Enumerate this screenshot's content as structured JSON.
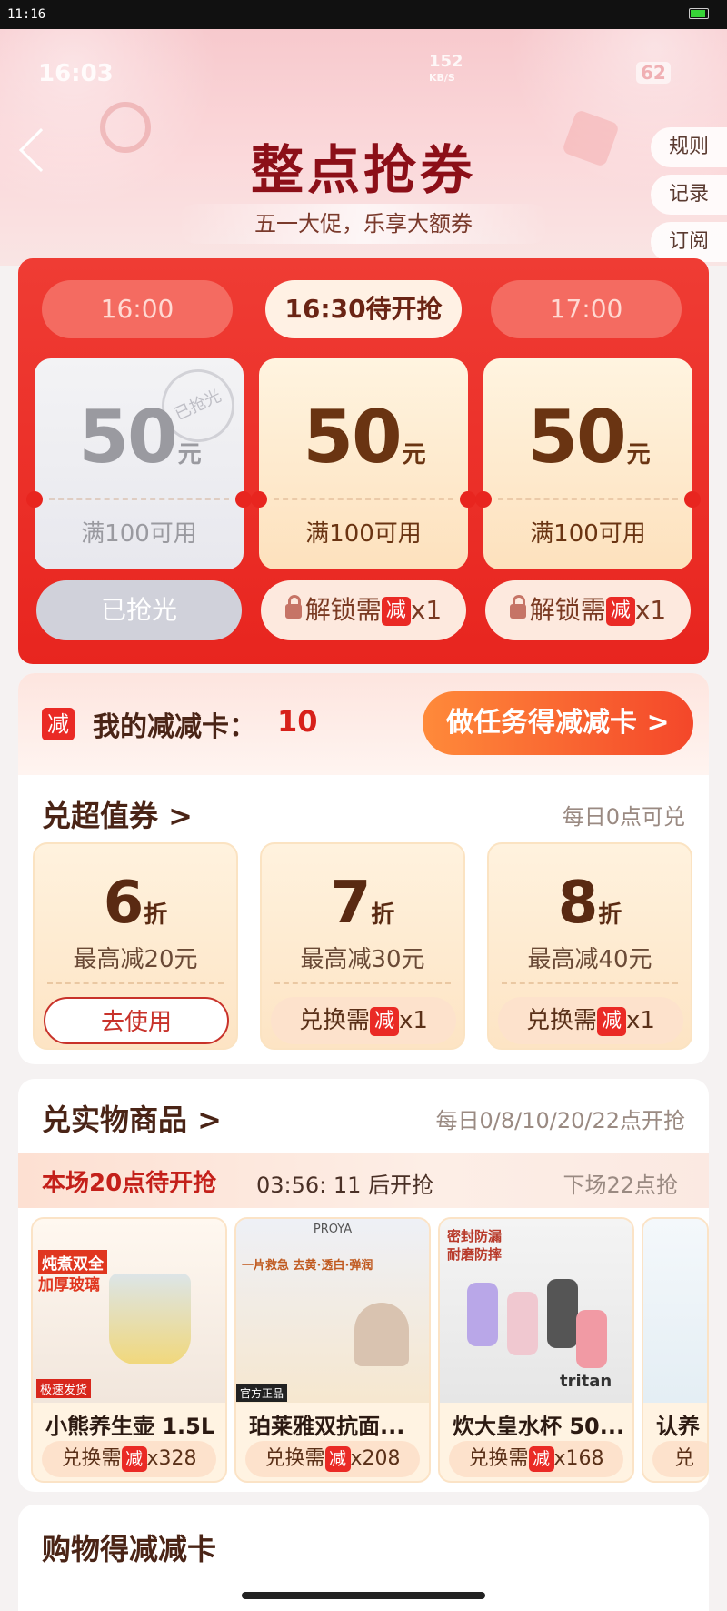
{
  "system": {
    "time": "11:16"
  },
  "status": {
    "time": "16:03",
    "net_speed": "152",
    "net_unit": "KB/S",
    "battery": "62"
  },
  "header": {
    "title": "整点抢券",
    "subtitle": "五一大促，乐享大额券",
    "side_links": [
      "规则",
      "记录",
      "订阅"
    ]
  },
  "timeslots": [
    "16:00",
    "16:30待开抢",
    "17:00"
  ],
  "coupons": [
    {
      "amount": "50",
      "unit": "元",
      "condition": "满100可用",
      "stamp": "已抢光",
      "button": "已抢光"
    },
    {
      "amount": "50",
      "unit": "元",
      "condition": "满100可用",
      "button_prefix": "解锁需",
      "button_icon": "减",
      "button_suffix": "x1"
    },
    {
      "amount": "50",
      "unit": "元",
      "condition": "满100可用",
      "button_prefix": "解锁需",
      "button_icon": "减",
      "button_suffix": "x1"
    }
  ],
  "mycard": {
    "icon": "减",
    "label": "我的减减卡：",
    "count": "10",
    "task_button": "做任务得减减卡 >"
  },
  "exchange": {
    "title": "兑超值券 >",
    "note": "每日0点可兑",
    "items": [
      {
        "discount": "6",
        "unit": "折",
        "desc": "最高减20元",
        "button": "去使用"
      },
      {
        "discount": "7",
        "unit": "折",
        "desc": "最高减30元",
        "button_prefix": "兑换需",
        "button_icon": "减",
        "button_suffix": "x1"
      },
      {
        "discount": "8",
        "unit": "折",
        "desc": "最高减40元",
        "button_prefix": "兑换需",
        "button_icon": "减",
        "button_suffix": "x1"
      }
    ]
  },
  "goods": {
    "title": "兑实物商品 >",
    "note": "每日0/8/10/20/22点开抢",
    "current": "本场20点待开抢",
    "countdown": "03:56: 11 后开抢",
    "next": "下场22点抢",
    "items": [
      {
        "name": "小熊养生壶 1.5L",
        "button_prefix": "兑换需",
        "button_icon": "减",
        "cost": "x328",
        "img_text1": "炖煮双全",
        "img_text2": "加厚玻璃",
        "img_badge": "极速发货"
      },
      {
        "name": "珀莱雅双抗面...",
        "button_prefix": "兑换需",
        "button_icon": "减",
        "cost": "x208",
        "img_text1": "PROYA",
        "img_text2": "一片救急 去黄·透白·弹润",
        "img_badge": "官方正品"
      },
      {
        "name": "炊大皇水杯 50...",
        "button_prefix": "兑换需",
        "button_icon": "减",
        "cost": "x168",
        "img_text1": "密封防漏",
        "img_text2": "耐磨防摔",
        "img_badge": "tritan"
      },
      {
        "name": "认养",
        "button_prefix": "兑",
        "button_icon": "",
        "cost": ""
      }
    ]
  },
  "earn": {
    "title": "购物得减减卡"
  },
  "colors": {
    "accent_red": "#e8251f",
    "title_red": "#8c0f18",
    "gold": "#fde1bd",
    "orange_btn": "#f4472a"
  }
}
